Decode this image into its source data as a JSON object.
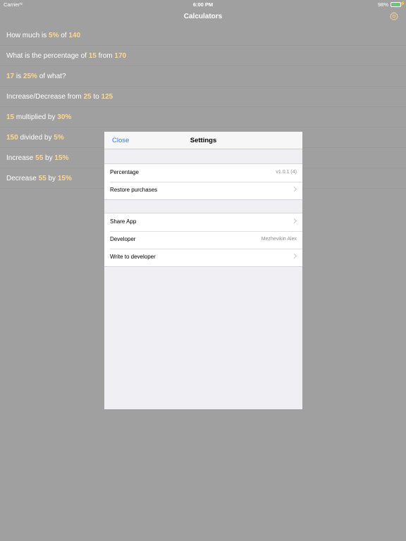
{
  "status_bar": {
    "carrier": "Carrier",
    "wifi_icon": "wifi-icon",
    "time": "6:00 PM",
    "battery_percent": "98%",
    "battery_color": "#4cd964"
  },
  "nav": {
    "title": "Calculators",
    "settings_icon": "gear-icon"
  },
  "calculators": [
    {
      "parts": [
        {
          "t": "How much is ",
          "h": false
        },
        {
          "t": "5%",
          "h": true
        },
        {
          "t": " of ",
          "h": false
        },
        {
          "t": "140",
          "h": true
        }
      ]
    },
    {
      "parts": [
        {
          "t": "What is the percentage of ",
          "h": false
        },
        {
          "t": "15",
          "h": true
        },
        {
          "t": " from ",
          "h": false
        },
        {
          "t": "170",
          "h": true
        }
      ]
    },
    {
      "parts": [
        {
          "t": "17",
          "h": true
        },
        {
          "t": " is ",
          "h": false
        },
        {
          "t": "25%",
          "h": true
        },
        {
          "t": " of what?",
          "h": false
        }
      ]
    },
    {
      "parts": [
        {
          "t": "Increase/Decrease from ",
          "h": false
        },
        {
          "t": "25",
          "h": true
        },
        {
          "t": " to ",
          "h": false
        },
        {
          "t": "125",
          "h": true
        }
      ]
    },
    {
      "parts": [
        {
          "t": "15",
          "h": true
        },
        {
          "t": " multiplied by ",
          "h": false
        },
        {
          "t": "30%",
          "h": true
        }
      ]
    },
    {
      "parts": [
        {
          "t": "150",
          "h": true
        },
        {
          "t": " divided by ",
          "h": false
        },
        {
          "t": "5%",
          "h": true
        }
      ]
    },
    {
      "parts": [
        {
          "t": "Increase ",
          "h": false
        },
        {
          "t": "55",
          "h": true
        },
        {
          "t": " by ",
          "h": false
        },
        {
          "t": "15%",
          "h": true
        }
      ]
    },
    {
      "parts": [
        {
          "t": "Decrease ",
          "h": false
        },
        {
          "t": "55",
          "h": true
        },
        {
          "t": " by ",
          "h": false
        },
        {
          "t": "15%",
          "h": true
        }
      ]
    }
  ],
  "settings": {
    "close_label": "Close",
    "title": "Settings",
    "group1": [
      {
        "label": "Percentage",
        "value": "v1.0.1 (4)"
      },
      {
        "label": "Restore purchases",
        "chevron": true
      }
    ],
    "group2": [
      {
        "label": "Share App",
        "chevron": true
      },
      {
        "label": "Developer",
        "value": "Mezhevikin Alex"
      },
      {
        "label": "Write to developer",
        "chevron": true
      }
    ]
  },
  "colors": {
    "accent": "#2e7cf6",
    "highlight": "#ffd98a",
    "dim_background": "#a0a0a0"
  }
}
